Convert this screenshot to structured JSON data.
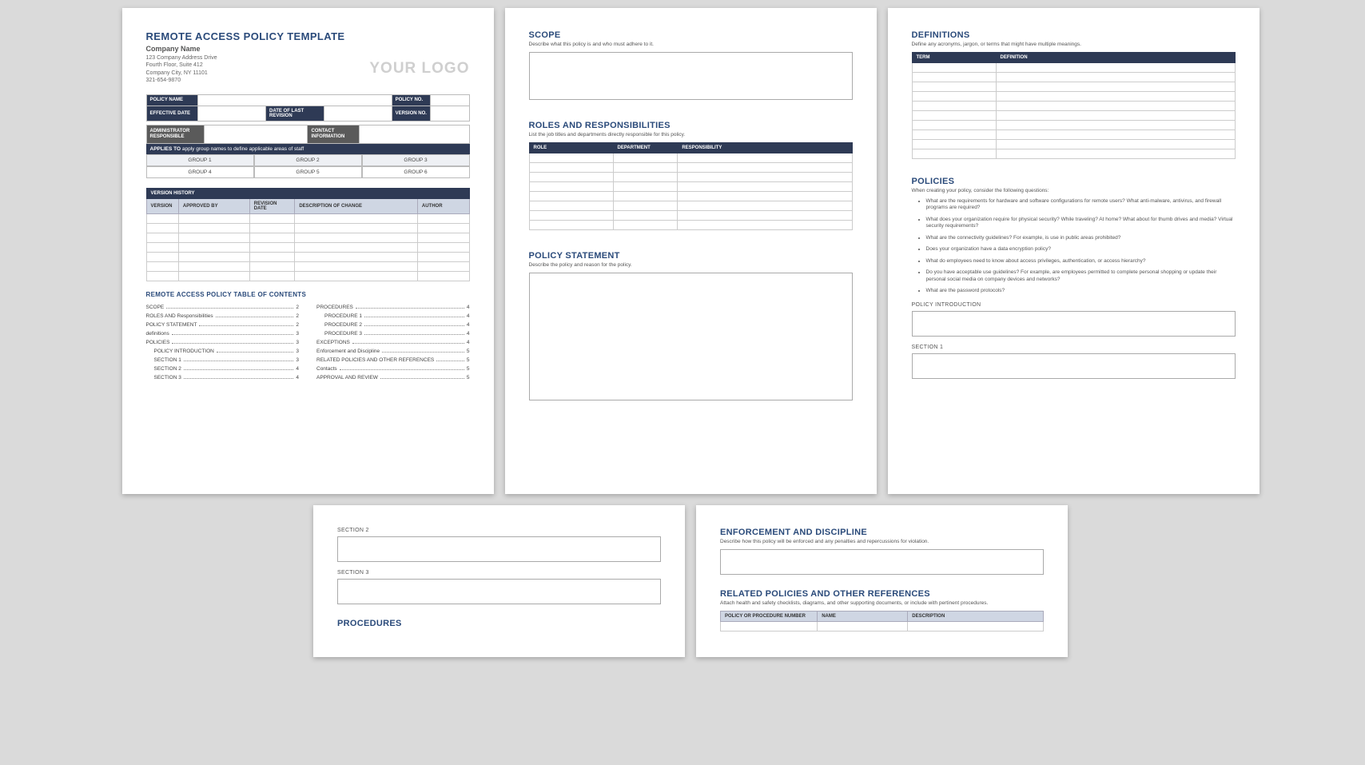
{
  "page1": {
    "title": "REMOTE ACCESS POLICY TEMPLATE",
    "company_name": "Company Name",
    "addr1": "123 Company Address Drive",
    "addr2": "Fourth Floor, Suite 412",
    "addr3": "Company City, NY  11101",
    "addr4": "321-654-9870",
    "logo": "YOUR LOGO",
    "meta": {
      "policy_name": "POLICY NAME",
      "policy_no": "POLICY NO.",
      "effective_date": "EFFECTIVE DATE",
      "date_last_rev": "DATE OF LAST REVISION",
      "version_no": "VERSION NO.",
      "admin_resp": "ADMINISTRATOR RESPONSIBLE",
      "contact_info": "CONTACT INFORMATION"
    },
    "applies_to_label": "APPLIES TO",
    "applies_to_text": "apply group names to define applicable areas of staff",
    "groups": [
      "GROUP 1",
      "GROUP 2",
      "GROUP 3",
      "GROUP 4",
      "GROUP 5",
      "GROUP 6"
    ],
    "version_history": "VERSION HISTORY",
    "vh_headers": [
      "VERSION",
      "APPROVED BY",
      "REVISION DATE",
      "DESCRIPTION OF CHANGE",
      "AUTHOR"
    ],
    "toc_title": "REMOTE ACCESS POLICY TABLE OF CONTENTS",
    "toc_left": [
      {
        "label": "SCOPE",
        "page": "2",
        "indent": false
      },
      {
        "label": "ROLES AND Responsibilities",
        "page": "2",
        "indent": false
      },
      {
        "label": "POLICY STATEMENT",
        "page": "2",
        "indent": false
      },
      {
        "label": "definitions",
        "page": "3",
        "indent": false
      },
      {
        "label": "POLICIES",
        "page": "3",
        "indent": false
      },
      {
        "label": "POLICY INTRODUCTION",
        "page": "3",
        "indent": true
      },
      {
        "label": "SECTION 1",
        "page": "3",
        "indent": true
      },
      {
        "label": "SECTION 2",
        "page": "4",
        "indent": true
      },
      {
        "label": "SECTION 3",
        "page": "4",
        "indent": true
      }
    ],
    "toc_right": [
      {
        "label": "PROCEDURES",
        "page": "4",
        "indent": false
      },
      {
        "label": "PROCEDURE 1",
        "page": "4",
        "indent": true
      },
      {
        "label": "PROCEDURE 2",
        "page": "4",
        "indent": true
      },
      {
        "label": "PROCEDURE 3",
        "page": "4",
        "indent": true
      },
      {
        "label": "EXCEPTIONS",
        "page": "4",
        "indent": false
      },
      {
        "label": "Enforcement and Discipline",
        "page": "5",
        "indent": false
      },
      {
        "label": "RELATED POLICIES AND OTHER REFERENCES",
        "page": "5",
        "indent": false
      },
      {
        "label": "Contacts",
        "page": "5",
        "indent": false
      },
      {
        "label": "APPROVAL AND REVIEW",
        "page": "5",
        "indent": false
      }
    ]
  },
  "page2": {
    "scope_h": "SCOPE",
    "scope_sub": "Describe what this policy is and who must adhere to it.",
    "roles_h": "ROLES AND RESPONSIBILITIES",
    "roles_sub": "List the job titles and departments directly responsible for this policy.",
    "roles_headers": [
      "ROLE",
      "DEPARTMENT",
      "RESPONSIBILITY"
    ],
    "ps_h": "POLICY STATEMENT",
    "ps_sub": "Describe the policy and reason for the policy."
  },
  "page3": {
    "def_h": "DEFINITIONS",
    "def_sub": "Define any acronyms, jargon, or terms that might have multiple meanings.",
    "def_headers": [
      "TERM",
      "DEFINITION"
    ],
    "pol_h": "POLICIES",
    "pol_sub": "When creating your policy, consider the following questions:",
    "bullets": [
      "What are the requirements for hardware and software configurations for remote users? What anti-malware, antivirus, and firewall programs are required?",
      "What does your organization require for physical security? While traveling? At home? What about for thumb drives and media? Virtual security requirements?",
      "What are the connectivity guidelines? For example, is use in public areas prohibited?",
      "Does your organization have a data encryption policy?",
      "What do employees need to know about access privileges, authentication, or access hierarchy?",
      "Do you have acceptable use guidelines? For example, are employees permitted to complete personal shopping or update their personal social media on company devices and networks?",
      "What are the password protocols?"
    ],
    "policy_intro_h": "POLICY INTRODUCTION",
    "section1_h": "SECTION 1"
  },
  "page4": {
    "section2_h": "SECTION 2",
    "section3_h": "SECTION 3",
    "procedures_h": "PROCEDURES"
  },
  "page5": {
    "enf_h": "ENFORCEMENT AND DISCIPLINE",
    "enf_sub": "Describe how this policy will be enforced and any penalties and repercussions for violation.",
    "rel_h": "RELATED POLICIES AND OTHER REFERENCES",
    "rel_sub": "Attach health and safety checklists, diagrams, and other supporting documents, or include with pertinent procedures.",
    "rel_headers": [
      "POLICY OR PROCEDURE NUMBER",
      "NAME",
      "DESCRIPTION"
    ]
  }
}
